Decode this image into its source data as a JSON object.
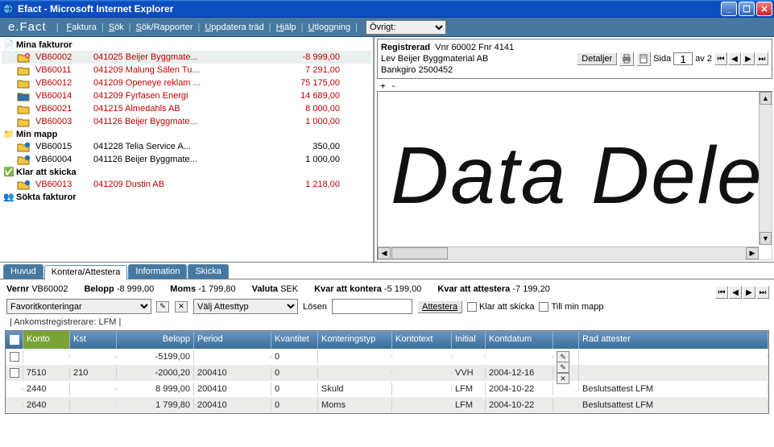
{
  "window": {
    "title": "Efact       - Microsoft Internet Explorer"
  },
  "menu": {
    "logo": "e.Fact",
    "items": [
      "Faktura",
      "Sök",
      "Sök/Rapporter",
      "Uppdatera träd",
      "Hjälp",
      "Utloggning"
    ],
    "select_label": "Övrigt:"
  },
  "tree": {
    "sections": [
      {
        "title": "Mina fakturor",
        "rows": [
          {
            "id": "VB60002",
            "desc": "041025 Beijer Byggmate...",
            "amount": "-8 999,00",
            "color": "red",
            "sel": true,
            "folder": "red-x"
          },
          {
            "id": "VB60011",
            "desc": "041209 Malung Sälen Tu...",
            "amount": "7 291,00",
            "color": "red",
            "folder": "yellow"
          },
          {
            "id": "VB60012",
            "desc": "041209 Openeye reklam ...",
            "amount": "75 175,00",
            "color": "red",
            "folder": "yellow"
          },
          {
            "id": "VB60014",
            "desc": "041209 Fyrfasen Energi",
            "amount": "14 689,00",
            "color": "red",
            "folder": "blue"
          },
          {
            "id": "VB60021",
            "desc": "041215 Almedahls AB",
            "amount": "8 000,00",
            "color": "red",
            "folder": "yellow"
          },
          {
            "id": "VB60003",
            "desc": "041126 Beijer Byggmate...",
            "amount": "1 000,00",
            "color": "red",
            "folder": "yellow"
          }
        ]
      },
      {
        "title": "Min mapp",
        "rows": [
          {
            "id": "VB60015",
            "desc": "041228 Telia Service A...",
            "amount": "350,00",
            "color": "black",
            "folder": "yellow-blue"
          },
          {
            "id": "VB60004",
            "desc": "041126 Beijer Byggmate...",
            "amount": "1 000,00",
            "color": "black",
            "folder": "yellow-blue"
          }
        ]
      },
      {
        "title": "Klar att skicka",
        "rows": [
          {
            "id": "VB60013",
            "desc": "041209 Dustin AB",
            "amount": "1 218,00",
            "color": "red",
            "folder": "yellow-blue"
          }
        ]
      },
      {
        "title": "Sökta fakturor",
        "rows": []
      }
    ]
  },
  "doc": {
    "line1a": "Registrerad",
    "line1b": "Vnr 60002  Fnr 4141",
    "line2": "Lev Beijer Byggmaterial AB",
    "line3": "Bankgiro 2500452",
    "detaljer": "Detaljer",
    "sida_label": "Sida",
    "sida_value": "1",
    "av": "av 2",
    "plusminus": "+ -",
    "bigtext": "Data Dele"
  },
  "tabs": [
    "Huvud",
    "Kontera/Attestera",
    "Information",
    "Skicka"
  ],
  "active_tab": 1,
  "summary": {
    "vernr_l": "Vernr",
    "vernr": "VB60002",
    "belopp_l": "Belopp",
    "belopp": "-8 999,00",
    "moms_l": "Moms",
    "moms": "-1 799,80",
    "valuta_l": "Valuta",
    "valuta": "SEK",
    "kvar_kont_l": "Kvar att kontera",
    "kvar_kont": "-5 199,00",
    "kvar_att_l": "Kvar att attestera",
    "kvar_att": "-7 199,20"
  },
  "filters": {
    "favorit": "Favoritkonteringar",
    "valj": "Välj Attesttyp",
    "losen": "Lösen",
    "attestera": "Attestera",
    "klar": "Klar att skicka",
    "till": "Till min mapp"
  },
  "subtext": "|  Ankomstregistrerare: LFM |",
  "table": {
    "headers": [
      "Konto",
      "Kst",
      "Belopp",
      "Period",
      "Kvantitet",
      "Konteringstyp",
      "Kontotext",
      "Initial",
      "Kontdatum",
      "",
      "Rad attester"
    ],
    "rows": [
      {
        "chk": true,
        "konto": "",
        "kst": "",
        "belopp": "-5199,00",
        "period": "",
        "kvant": "0",
        "ktyp": "",
        "ktxt": "",
        "init": "",
        "kdatum": "",
        "edit": "pen",
        "rad": ""
      },
      {
        "chk": true,
        "konto": "7510",
        "kst": "210",
        "belopp": "-2000,20",
        "period": "200410",
        "kvant": "0",
        "ktyp": "",
        "ktxt": "",
        "init": "VVH",
        "kdatum": "2004-12-16",
        "edit": "pen-x",
        "rad": ""
      },
      {
        "chk": false,
        "konto": "2440",
        "kst": "",
        "belopp": "8 999,00",
        "period": "200410",
        "kvant": "0",
        "ktyp": "Skuld",
        "ktxt": "",
        "init": "LFM",
        "kdatum": "2004-10-22",
        "edit": "",
        "rad": "Beslutsattest LFM"
      },
      {
        "chk": false,
        "konto": "2640",
        "kst": "",
        "belopp": "1 799,80",
        "period": "200410",
        "kvant": "0",
        "ktyp": "Moms",
        "ktxt": "",
        "init": "LFM",
        "kdatum": "2004-10-22",
        "edit": "",
        "rad": "Beslutsattest LFM"
      }
    ]
  }
}
